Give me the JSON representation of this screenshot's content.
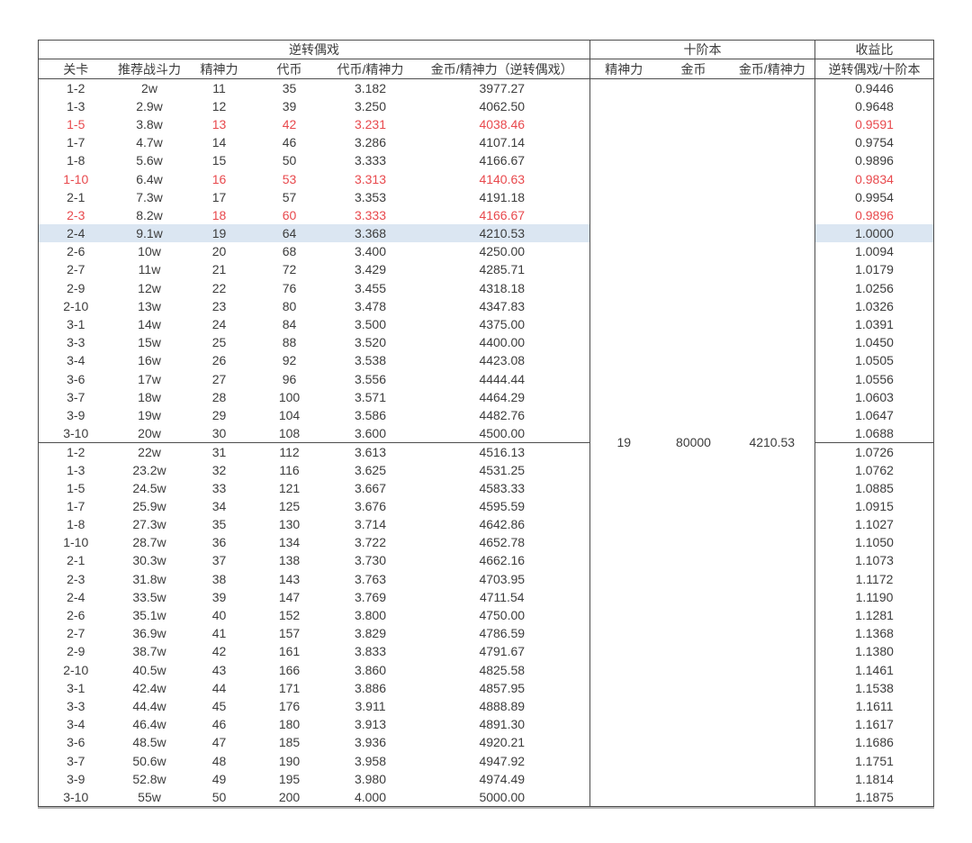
{
  "table": {
    "sections": [
      {
        "label": "逆转偶戏"
      },
      {
        "label": "十阶本"
      },
      {
        "label": "收益比"
      }
    ],
    "column_headers": {
      "stage": "关卡",
      "power": "推荐战斗力",
      "spirit": "精神力",
      "token": "代币",
      "token_per_spirit": "代币/精神力",
      "gold_per_spirit": "金币/精神力（逆转偶戏）",
      "t10_spirit": "精神力",
      "t10_gold": "金币",
      "t10_gold_per_spirit": "金币/精神力",
      "yield_ratio": "逆转偶戏/十阶本"
    },
    "tier10": {
      "spirit": "19",
      "gold": "80000",
      "gold_per_spirit": "4210.53"
    },
    "rows": [
      {
        "stage": "1-2",
        "power": "2w",
        "spirit": "11",
        "token": "35",
        "tps": "3.182",
        "gps": "3977.27",
        "yield": "0.9446",
        "style": "normal"
      },
      {
        "stage": "1-3",
        "power": "2.9w",
        "spirit": "12",
        "token": "39",
        "tps": "3.250",
        "gps": "4062.50",
        "yield": "0.9648",
        "style": "normal"
      },
      {
        "stage": "1-5",
        "power": "3.8w",
        "spirit": "13",
        "token": "42",
        "tps": "3.231",
        "gps": "4038.46",
        "yield": "0.9591",
        "style": "red"
      },
      {
        "stage": "1-7",
        "power": "4.7w",
        "spirit": "14",
        "token": "46",
        "tps": "3.286",
        "gps": "4107.14",
        "yield": "0.9754",
        "style": "normal"
      },
      {
        "stage": "1-8",
        "power": "5.6w",
        "spirit": "15",
        "token": "50",
        "tps": "3.333",
        "gps": "4166.67",
        "yield": "0.9896",
        "style": "normal"
      },
      {
        "stage": "1-10",
        "power": "6.4w",
        "spirit": "16",
        "token": "53",
        "tps": "3.313",
        "gps": "4140.63",
        "yield": "0.9834",
        "style": "red"
      },
      {
        "stage": "2-1",
        "power": "7.3w",
        "spirit": "17",
        "token": "57",
        "tps": "3.353",
        "gps": "4191.18",
        "yield": "0.9954",
        "style": "normal"
      },
      {
        "stage": "2-3",
        "power": "8.2w",
        "spirit": "18",
        "token": "60",
        "tps": "3.333",
        "gps": "4166.67",
        "yield": "0.9896",
        "style": "red"
      },
      {
        "stage": "2-4",
        "power": "9.1w",
        "spirit": "19",
        "token": "64",
        "tps": "3.368",
        "gps": "4210.53",
        "yield": "1.0000",
        "style": "highlight"
      },
      {
        "stage": "2-6",
        "power": "10w",
        "spirit": "20",
        "token": "68",
        "tps": "3.400",
        "gps": "4250.00",
        "yield": "1.0094",
        "style": "normal"
      },
      {
        "stage": "2-7",
        "power": "11w",
        "spirit": "21",
        "token": "72",
        "tps": "3.429",
        "gps": "4285.71",
        "yield": "1.0179",
        "style": "normal"
      },
      {
        "stage": "2-9",
        "power": "12w",
        "spirit": "22",
        "token": "76",
        "tps": "3.455",
        "gps": "4318.18",
        "yield": "1.0256",
        "style": "normal"
      },
      {
        "stage": "2-10",
        "power": "13w",
        "spirit": "23",
        "token": "80",
        "tps": "3.478",
        "gps": "4347.83",
        "yield": "1.0326",
        "style": "normal"
      },
      {
        "stage": "3-1",
        "power": "14w",
        "spirit": "24",
        "token": "84",
        "tps": "3.500",
        "gps": "4375.00",
        "yield": "1.0391",
        "style": "normal"
      },
      {
        "stage": "3-3",
        "power": "15w",
        "spirit": "25",
        "token": "88",
        "tps": "3.520",
        "gps": "4400.00",
        "yield": "1.0450",
        "style": "normal"
      },
      {
        "stage": "3-4",
        "power": "16w",
        "spirit": "26",
        "token": "92",
        "tps": "3.538",
        "gps": "4423.08",
        "yield": "1.0505",
        "style": "normal"
      },
      {
        "stage": "3-6",
        "power": "17w",
        "spirit": "27",
        "token": "96",
        "tps": "3.556",
        "gps": "4444.44",
        "yield": "1.0556",
        "style": "normal"
      },
      {
        "stage": "3-7",
        "power": "18w",
        "spirit": "28",
        "token": "100",
        "tps": "3.571",
        "gps": "4464.29",
        "yield": "1.0603",
        "style": "normal"
      },
      {
        "stage": "3-9",
        "power": "19w",
        "spirit": "29",
        "token": "104",
        "tps": "3.586",
        "gps": "4482.76",
        "yield": "1.0647",
        "style": "normal"
      },
      {
        "stage": "3-10",
        "power": "20w",
        "spirit": "30",
        "token": "108",
        "tps": "3.600",
        "gps": "4500.00",
        "yield": "1.0688",
        "style": "normal"
      },
      {
        "stage": "1-2",
        "power": "22w",
        "spirit": "31",
        "token": "112",
        "tps": "3.613",
        "gps": "4516.13",
        "yield": "1.0726",
        "style": "normal"
      },
      {
        "stage": "1-3",
        "power": "23.2w",
        "spirit": "32",
        "token": "116",
        "tps": "3.625",
        "gps": "4531.25",
        "yield": "1.0762",
        "style": "normal"
      },
      {
        "stage": "1-5",
        "power": "24.5w",
        "spirit": "33",
        "token": "121",
        "tps": "3.667",
        "gps": "4583.33",
        "yield": "1.0885",
        "style": "normal"
      },
      {
        "stage": "1-7",
        "power": "25.9w",
        "spirit": "34",
        "token": "125",
        "tps": "3.676",
        "gps": "4595.59",
        "yield": "1.0915",
        "style": "normal"
      },
      {
        "stage": "1-8",
        "power": "27.3w",
        "spirit": "35",
        "token": "130",
        "tps": "3.714",
        "gps": "4642.86",
        "yield": "1.1027",
        "style": "normal"
      },
      {
        "stage": "1-10",
        "power": "28.7w",
        "spirit": "36",
        "token": "134",
        "tps": "3.722",
        "gps": "4652.78",
        "yield": "1.1050",
        "style": "normal"
      },
      {
        "stage": "2-1",
        "power": "30.3w",
        "spirit": "37",
        "token": "138",
        "tps": "3.730",
        "gps": "4662.16",
        "yield": "1.1073",
        "style": "normal"
      },
      {
        "stage": "2-3",
        "power": "31.8w",
        "spirit": "38",
        "token": "143",
        "tps": "3.763",
        "gps": "4703.95",
        "yield": "1.1172",
        "style": "normal"
      },
      {
        "stage": "2-4",
        "power": "33.5w",
        "spirit": "39",
        "token": "147",
        "tps": "3.769",
        "gps": "4711.54",
        "yield": "1.1190",
        "style": "normal"
      },
      {
        "stage": "2-6",
        "power": "35.1w",
        "spirit": "40",
        "token": "152",
        "tps": "3.800",
        "gps": "4750.00",
        "yield": "1.1281",
        "style": "normal"
      },
      {
        "stage": "2-7",
        "power": "36.9w",
        "spirit": "41",
        "token": "157",
        "tps": "3.829",
        "gps": "4786.59",
        "yield": "1.1368",
        "style": "normal"
      },
      {
        "stage": "2-9",
        "power": "38.7w",
        "spirit": "42",
        "token": "161",
        "tps": "3.833",
        "gps": "4791.67",
        "yield": "1.1380",
        "style": "normal"
      },
      {
        "stage": "2-10",
        "power": "40.5w",
        "spirit": "43",
        "token": "166",
        "tps": "3.860",
        "gps": "4825.58",
        "yield": "1.1461",
        "style": "normal"
      },
      {
        "stage": "3-1",
        "power": "42.4w",
        "spirit": "44",
        "token": "171",
        "tps": "3.886",
        "gps": "4857.95",
        "yield": "1.1538",
        "style": "normal"
      },
      {
        "stage": "3-3",
        "power": "44.4w",
        "spirit": "45",
        "token": "176",
        "tps": "3.911",
        "gps": "4888.89",
        "yield": "1.1611",
        "style": "normal"
      },
      {
        "stage": "3-4",
        "power": "46.4w",
        "spirit": "46",
        "token": "180",
        "tps": "3.913",
        "gps": "4891.30",
        "yield": "1.1617",
        "style": "normal"
      },
      {
        "stage": "3-6",
        "power": "48.5w",
        "spirit": "47",
        "token": "185",
        "tps": "3.936",
        "gps": "4920.21",
        "yield": "1.1686",
        "style": "normal"
      },
      {
        "stage": "3-7",
        "power": "50.6w",
        "spirit": "48",
        "token": "190",
        "tps": "3.958",
        "gps": "4947.92",
        "yield": "1.1751",
        "style": "normal"
      },
      {
        "stage": "3-9",
        "power": "52.8w",
        "spirit": "49",
        "token": "195",
        "tps": "3.980",
        "gps": "4974.49",
        "yield": "1.1814",
        "style": "normal"
      },
      {
        "stage": "3-10",
        "power": "55w",
        "spirit": "50",
        "token": "200",
        "tps": "4.000",
        "gps": "5000.00",
        "yield": "1.1875",
        "style": "normal"
      }
    ],
    "section_break_after_row": 20,
    "colors": {
      "red_text": "#e8494d",
      "highlight_row": "#dbe6f2",
      "grid_line": "#4d4d4d",
      "text": "#3c3c3c"
    }
  }
}
